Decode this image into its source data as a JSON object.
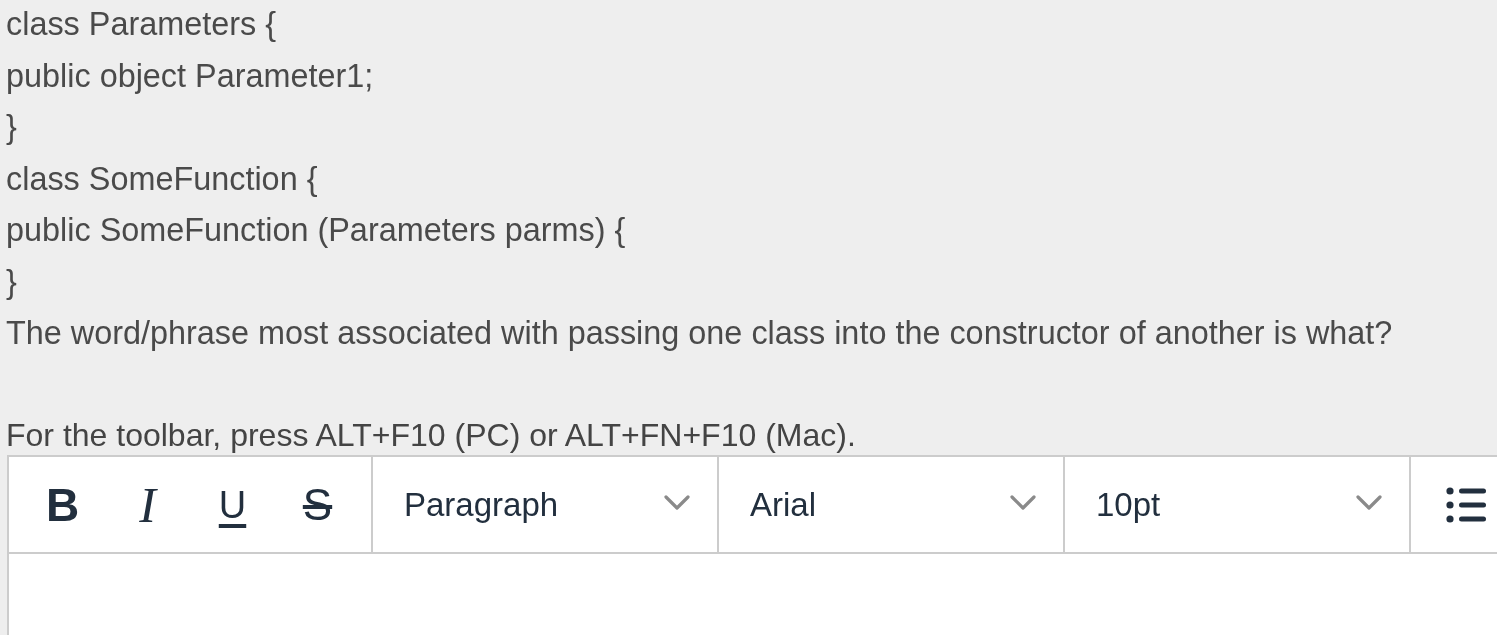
{
  "question": {
    "code_lines": [
      "class Parameters {",
      "public object Parameter1;",
      "}",
      "class SomeFunction {",
      "public SomeFunction (Parameters parms) {",
      "}"
    ],
    "prompt": "The word/phrase most associated with passing one class into the constructor of another is what?"
  },
  "toolbar_hint": "For the toolbar, press ALT+F10 (PC) or ALT+FN+F10 (Mac).",
  "editor": {
    "format_buttons": [
      {
        "kind": "bold",
        "label": "B"
      },
      {
        "kind": "italic",
        "label": "I"
      },
      {
        "kind": "underline",
        "label": "U"
      },
      {
        "kind": "strikethrough",
        "label": "S"
      }
    ],
    "dropdowns": [
      "Paragraph",
      "Arial",
      "10pt"
    ]
  }
}
